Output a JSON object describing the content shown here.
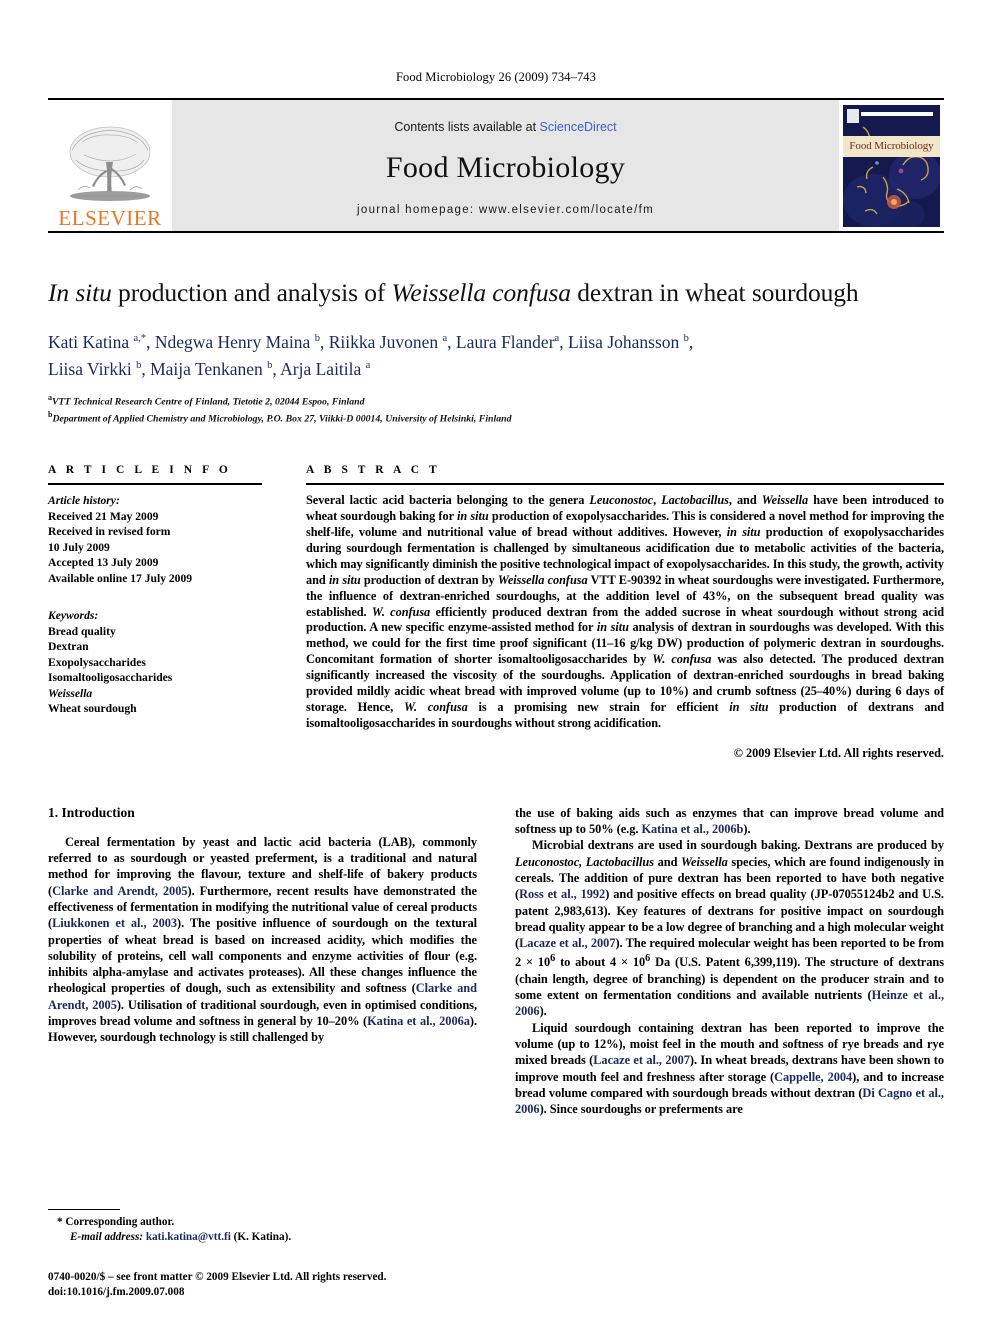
{
  "running_head": "Food Microbiology 26 (2009) 734–743",
  "masthead": {
    "publisher_wordmark": "ELSEVIER",
    "contents_prefix": "Contents lists available at ",
    "contents_link": "ScienceDirect",
    "journal_name": "Food Microbiology",
    "homepage": "journal homepage: www.elsevier.com/locate/fm",
    "cover_title": "Food Microbiology"
  },
  "title": {
    "part1_italic": "In situ",
    "part2": " production and analysis of ",
    "part3_italic": "Weissella confusa",
    "part4": " dextran in wheat sourdough",
    "full": "In situ production and analysis of Weissella confusa dextran in wheat sourdough"
  },
  "authors_line1": "Kati Katina a,*, Ndegwa Henry Maina b, Riikka Juvonen a, Laura Flander a, Liisa Johansson b,",
  "authors_line2": "Liisa Virkki b, Maija Tenkanen b, Arja Laitila a",
  "affiliations": [
    {
      "mark": "a",
      "text": "VTT Technical Research Centre of Finland, Tietotie 2, 02044 Espoo, Finland"
    },
    {
      "mark": "b",
      "text": "Department of Applied Chemistry and Microbiology, P.O. Box 27, Viikki-D 00014, University of Helsinki, Finland"
    }
  ],
  "article_info": {
    "heading": "A R T I C L E  I N F O",
    "history_label": "Article history:",
    "history": [
      "Received 21 May 2009",
      "Received in revised form",
      "10 July 2009",
      "Accepted 13 July 2009",
      "Available online 17 July 2009"
    ],
    "keywords_label": "Keywords:",
    "keywords": [
      {
        "text": "Bread quality",
        "italic": false
      },
      {
        "text": "Dextran",
        "italic": false
      },
      {
        "text": "Exopolysaccharides",
        "italic": false
      },
      {
        "text": "Isomaltooligosaccharides",
        "italic": false
      },
      {
        "text": "Weissella",
        "italic": true
      },
      {
        "text": "Wheat sourdough",
        "italic": false
      }
    ]
  },
  "abstract": {
    "heading": "A B S T R A C T",
    "text": "Several lactic acid bacteria belonging to the genera Leuconostoc, Lactobacillus, and Weissella have been introduced to wheat sourdough baking for in situ production of exopolysaccharides. This is considered a novel method for improving the shelf-life, volume and nutritional value of bread without additives. However, in situ production of exopolysaccharides during sourdough fermentation is challenged by simultaneous acidification due to metabolic activities of the bacteria, which may significantly diminish the positive technological impact of exopolysaccharides. In this study, the growth, activity and in situ production of dextran by Weissella confusa VTT E-90392 in wheat sourdoughs were investigated. Furthermore, the influence of dextran-enriched sourdoughs, at the addition level of 43%, on the subsequent bread quality was established. W. confusa efficiently produced dextran from the added sucrose in wheat sourdough without strong acid production. A new specific enzyme-assisted method for in situ analysis of dextran in sourdoughs was developed. With this method, we could for the first time proof significant (11–16 g/kg DW) production of polymeric dextran in sourdoughs. Concomitant formation of shorter isomaltooligosaccharides by W. confusa was also detected. The produced dextran significantly increased the viscosity of the sourdoughs. Application of dextran-enriched sourdoughs in bread baking provided mildly acidic wheat bread with improved volume (up to 10%) and crumb softness (25–40%) during 6 days of storage. Hence, W. confusa is a promising new strain for efficient in situ production of dextrans and isomaltooligosaccharides in sourdoughs without strong acidification.",
    "copyright": "© 2009 Elsevier Ltd. All rights reserved."
  },
  "body": {
    "section_number_title": "1. Introduction",
    "left_paragraph": "Cereal fermentation by yeast and lactic acid bacteria (LAB), commonly referred to as sourdough or yeasted preferment, is a traditional and natural method for improving the flavour, texture and shelf-life of bakery products (Clarke and Arendt, 2005). Furthermore, recent results have demonstrated the effectiveness of fermentation in modifying the nutritional value of cereal products (Liukkonen et al., 2003). The positive influence of sourdough on the textural properties of wheat bread is based on increased acidity, which modifies the solubility of proteins, cell wall components and enzyme activities of flour (e.g. inhibits alpha-amylase and activates proteases). All these changes influence the rheological properties of dough, such as extensibility and softness (Clarke and Arendt, 2005). Utilisation of traditional sourdough, even in optimised conditions, improves bread volume and softness in general by 10–20% (Katina et al., 2006a). However, sourdough technology is still challenged by",
    "right_paragraph_1": "the use of baking aids such as enzymes that can improve bread volume and softness up to 50% (e.g. Katina et al., 2006b).",
    "right_paragraph_2": "Microbial dextrans are used in sourdough baking. Dextrans are produced by Leuconostoc, Lactobacillus and Weissella species, which are found indigenously in cereals. The addition of pure dextran has been reported to have both negative (Ross et al., 1992) and positive effects on bread quality (JP-07055124b2 and U.S. patent 2,983,613). Key features of dextrans for positive impact on sourdough bread quality appear to be a low degree of branching and a high molecular weight (Lacaze et al., 2007). The required molecular weight has been reported to be from 2 × 10⁶ to about 4 × 10⁶ Da (U.S. Patent 6,399,119). The structure of dextrans (chain length, degree of branching) is dependent on the producer strain and to some extent on fermentation conditions and available nutrients (Heinze et al., 2006).",
    "right_paragraph_3": "Liquid sourdough containing dextran has been reported to improve the volume (up to 12%), moist feel in the mouth and softness of rye breads and rye mixed breads (Lacaze et al., 2007). In wheat breads, dextrans have been shown to improve mouth feel and freshness after storage (Cappelle, 2004), and to increase bread volume compared with sourdough breads without dextran (Di Cagno et al., 2006). Since sourdoughs or preferments are"
  },
  "footnote": {
    "corresponding": "* Corresponding author.",
    "email_label": "E-mail address:",
    "email": "kati.katina@vtt.fi",
    "email_suffix": "(K. Katina).",
    "front_matter": "0740-0020/$ – see front matter © 2009 Elsevier Ltd. All rights reserved.",
    "doi": "doi:10.1016/j.fm.2009.07.008"
  },
  "colors": {
    "elsevier_orange": "#E87722",
    "citation_blue": "#1b2a5e",
    "link_blue": "#3a5fcd",
    "banner_grey": "#e6e6e6"
  }
}
